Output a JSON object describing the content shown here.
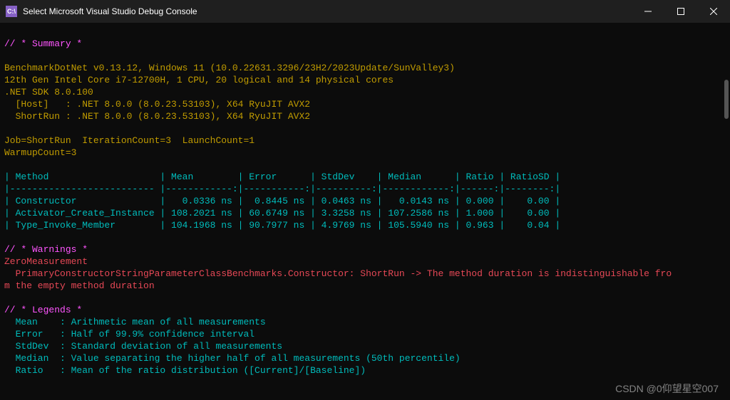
{
  "titlebar": {
    "icon_label": "C:\\",
    "title": "Select Microsoft Visual Studio Debug Console"
  },
  "summary": {
    "header": "// * Summary *",
    "env1": "BenchmarkDotNet v0.13.12, Windows 11 (10.0.22631.3296/23H2/2023Update/SunValley3)",
    "env2": "12th Gen Intel Core i7-12700H, 1 CPU, 20 logical and 14 physical cores",
    "env3": ".NET SDK 8.0.100",
    "env4": "  [Host]   : .NET 8.0.0 (8.0.23.53103), X64 RyuJIT AVX2",
    "env5": "  ShortRun : .NET 8.0.0 (8.0.23.53103), X64 RyuJIT AVX2",
    "job": "Job=ShortRun  IterationCount=3  LaunchCount=1",
    "warmup": "WarmupCount=3"
  },
  "table": {
    "head": "| Method                    | Mean        | Error      | StdDev    | Median      | Ratio | RatioSD |",
    "sep": "|-------------------------- |------------:|-----------:|----------:|------------:|------:|--------:|",
    "row1": "| Constructor               |   0.0336 ns |  0.8445 ns | 0.0463 ns |   0.0143 ns | 0.000 |    0.00 |",
    "row2": "| Activator_Create_Instance | 108.2021 ns | 60.6749 ns | 3.3258 ns | 107.2586 ns | 1.000 |    0.00 |",
    "row3": "| Type_Invoke_Member        | 104.1968 ns | 90.7977 ns | 4.9769 ns | 105.5940 ns | 0.963 |    0.04 |"
  },
  "warnings": {
    "header": "// * Warnings *",
    "name": "ZeroMeasurement",
    "msg1": "  PrimaryConstructorStringParameterClassBenchmarks.Constructor: ShortRun -> The method duration is indistinguishable fro",
    "msg2": "m the empty method duration"
  },
  "legends": {
    "header": "// * Legends *",
    "mean": "  Mean    : Arithmetic mean of all measurements",
    "error": "  Error   : Half of 99.9% confidence interval",
    "stddev": "  StdDev  : Standard deviation of all measurements",
    "median": "  Median  : Value separating the higher half of all measurements (50th percentile)",
    "ratio": "  Ratio   : Mean of the ratio distribution ([Current]/[Baseline])"
  },
  "watermark": "CSDN @0仰望星空007",
  "chart_data": {
    "type": "table",
    "title": "BenchmarkDotNet results",
    "columns": [
      "Method",
      "Mean",
      "Error",
      "StdDev",
      "Median",
      "Ratio",
      "RatioSD"
    ],
    "rows": [
      {
        "Method": "Constructor",
        "Mean_ns": 0.0336,
        "Error_ns": 0.8445,
        "StdDev_ns": 0.0463,
        "Median_ns": 0.0143,
        "Ratio": 0.0,
        "RatioSD": 0.0
      },
      {
        "Method": "Activator_Create_Instance",
        "Mean_ns": 108.2021,
        "Error_ns": 60.6749,
        "StdDev_ns": 3.3258,
        "Median_ns": 107.2586,
        "Ratio": 1.0,
        "RatioSD": 0.0
      },
      {
        "Method": "Type_Invoke_Member",
        "Mean_ns": 104.1968,
        "Error_ns": 90.7977,
        "StdDev_ns": 4.9769,
        "Median_ns": 105.594,
        "Ratio": 0.963,
        "RatioSD": 0.04
      }
    ]
  }
}
